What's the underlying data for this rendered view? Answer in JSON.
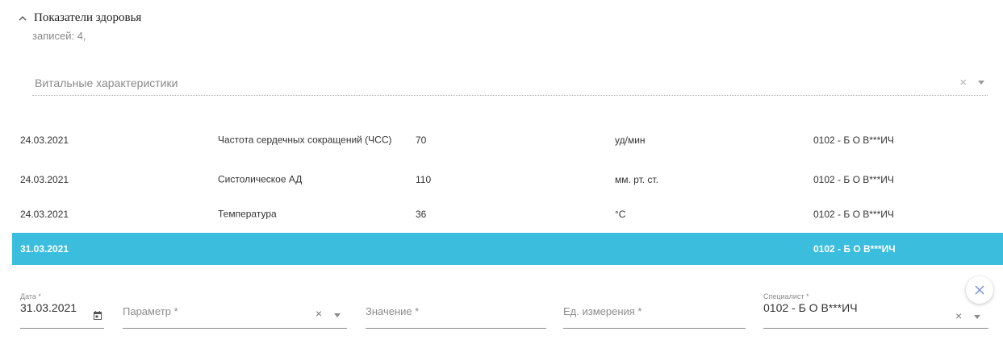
{
  "section": {
    "title": "Показатели здоровья",
    "record_count": "записей: 4,"
  },
  "filter": {
    "value": "Витальные характеристики",
    "clear_glyph": "×"
  },
  "table": {
    "rows": [
      {
        "date": "24.03.2021",
        "parameter": "Частота сердечных сокращений (ЧСС)",
        "value": "70",
        "unit": "уд/мин",
        "specialist": "0102 - Б О В***ИЧ"
      },
      {
        "date": "24.03.2021",
        "parameter": "Систолическое АД",
        "value": "110",
        "unit": "мм. рт. ст.",
        "specialist": "0102 - Б О В***ИЧ"
      },
      {
        "date": "24.03.2021",
        "parameter": "Температура",
        "value": "36",
        "unit": "°C",
        "specialist": "0102 - Б О В***ИЧ"
      },
      {
        "date": "31.03.2021",
        "parameter": "",
        "value": "",
        "unit": "",
        "specialist": "0102 - Б О В***ИЧ",
        "selected": true
      }
    ]
  },
  "form": {
    "date": {
      "label": "Дата *",
      "value": "31.03.2021"
    },
    "parameter": {
      "placeholder": "Параметр *"
    },
    "value": {
      "placeholder": "Значение *"
    },
    "unit": {
      "placeholder": "Ед. измерения *"
    },
    "specialist": {
      "label": "Специалист *",
      "value": "0102 - Б О В***ИЧ"
    },
    "clear_glyph": "×"
  },
  "icons": {
    "collapse": "chevron-up-icon",
    "calendar": "calendar-icon",
    "close": "close-icon",
    "dropdown": "chevron-down-icon"
  },
  "colors": {
    "selected_row": "#3bbede",
    "close_icon": "#7b8fd6"
  }
}
